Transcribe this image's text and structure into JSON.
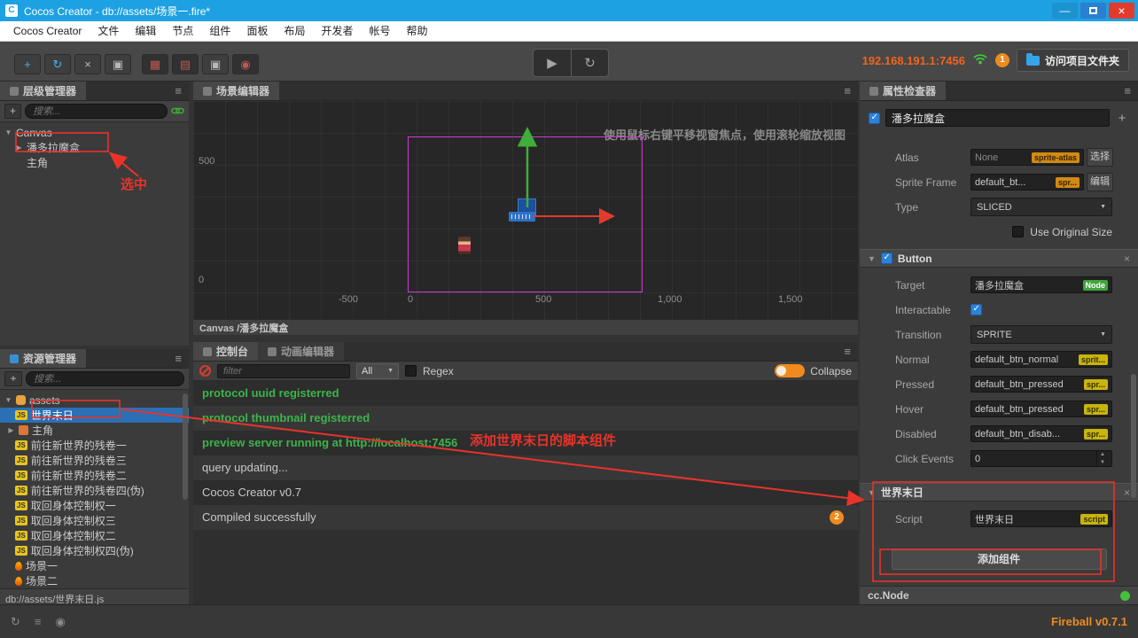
{
  "titlebar": {
    "title": "Cocos Creator - db://assets/场景一.fire*"
  },
  "menubar": {
    "items": [
      "Cocos Creator",
      "文件",
      "编辑",
      "节点",
      "组件",
      "面板",
      "布局",
      "开发者",
      "帐号",
      "帮助"
    ]
  },
  "toolbar": {
    "address": "192.168.191.1:7456",
    "badge": "1",
    "open_project_label": "访问项目文件夹"
  },
  "hierarchy": {
    "title": "层级管理器",
    "search_placeholder": "搜索...",
    "nodes": [
      {
        "label": "Canvas"
      },
      {
        "label": "潘多拉魔盒"
      },
      {
        "label": "主角"
      }
    ]
  },
  "scene": {
    "tab": "场景编辑器",
    "hint": "使用鼠标右键平移视窗焦点，使用滚轮缩放视图",
    "breadcrumb": "Canvas /潘多拉魔盒",
    "ruler_y": [
      "500",
      "0"
    ],
    "ruler_x": [
      "-500",
      "0",
      "500",
      "1,000",
      "1,500"
    ]
  },
  "console": {
    "tab_console": "控制台",
    "tab_anim": "动画编辑器",
    "filter_placeholder": "filter",
    "dropdown_value": "All",
    "regex_label": "Regex",
    "collapse_label": "Collapse",
    "logs": [
      {
        "text": "protocol uuid registerred",
        "type": "success"
      },
      {
        "text": "protocol thumbnail registerred",
        "type": "success"
      },
      {
        "text": "preview server running at http://localhost:7456",
        "type": "success"
      },
      {
        "text": "query updating...",
        "type": "normal"
      },
      {
        "text": "Cocos Creator v0.7",
        "type": "normal"
      },
      {
        "text": "Compiled successfully",
        "type": "normal",
        "badge": "2"
      }
    ]
  },
  "assets": {
    "title": "资源管理器",
    "search_placeholder": "搜索...",
    "path": "db://assets/世界末日.js",
    "items": [
      {
        "label": "assets",
        "icon": "db",
        "expanded": true
      },
      {
        "label": "世界末日",
        "icon": "js",
        "selected": true
      },
      {
        "label": "主角",
        "icon": "sprite",
        "collapsed": true
      },
      {
        "label": "前往新世界的残卷一",
        "icon": "js"
      },
      {
        "label": "前往新世界的残卷三",
        "icon": "js"
      },
      {
        "label": "前往新世界的残卷二",
        "icon": "js"
      },
      {
        "label": "前往新世界的残卷四(伪)",
        "icon": "js"
      },
      {
        "label": "取回身体控制权一",
        "icon": "js"
      },
      {
        "label": "取回身体控制权三",
        "icon": "js"
      },
      {
        "label": "取回身体控制权二",
        "icon": "js"
      },
      {
        "label": "取回身体控制权四(伪)",
        "icon": "js"
      },
      {
        "label": "场景一",
        "icon": "fire"
      },
      {
        "label": "场景二",
        "icon": "fire"
      }
    ]
  },
  "inspector": {
    "title": "属性检查器",
    "node_name": "潘多拉魔盒",
    "node_enabled": true,
    "atlas": {
      "label": "Atlas",
      "value": "None",
      "badge": "sprite-atlas",
      "button": "选择"
    },
    "sprite_frame": {
      "label": "Sprite Frame",
      "value": "default_bt...",
      "badge": "spr...",
      "button": "编辑"
    },
    "type": {
      "label": "Type",
      "value": "SLICED"
    },
    "use_original_size": {
      "label": "Use Original Size",
      "checked": false
    },
    "button": {
      "title": "Button",
      "enabled": true,
      "target": {
        "label": "Target",
        "value": "潘多拉魔盒",
        "badge": "Node"
      },
      "interactable": {
        "label": "Interactable",
        "checked": true
      },
      "transition": {
        "label": "Transition",
        "value": "SPRITE"
      },
      "normal": {
        "label": "Normal",
        "value": "default_btn_normal",
        "badge": "sprit..."
      },
      "pressed": {
        "label": "Pressed",
        "value": "default_btn_pressed",
        "badge": "spr..."
      },
      "hover": {
        "label": "Hover",
        "value": "default_btn_pressed",
        "badge": "spr..."
      },
      "disabled": {
        "label": "Disabled",
        "value": "default_btn_disab...",
        "badge": "spr..."
      },
      "click_events": {
        "label": "Click Events",
        "value": "0"
      }
    },
    "script": {
      "title": "世界末日",
      "script_row": {
        "label": "Script",
        "value": "世界末日",
        "badge": "script"
      },
      "add_component_label": "添加组件"
    },
    "footer": "cc.Node"
  },
  "statusbar": {
    "version": "Fireball v0.7.1"
  },
  "annotations": {
    "selected_label": "选中",
    "script_note": "添加世界末日的脚本组件"
  },
  "colors": {
    "titlebar_blue": "#1da1e2",
    "annotation_red": "#e8332a",
    "success_green": "#3cb44a",
    "accent_orange": "#ef8b1e",
    "address_orange": "#f2641c",
    "selection_blue": "#2b6fb4"
  }
}
